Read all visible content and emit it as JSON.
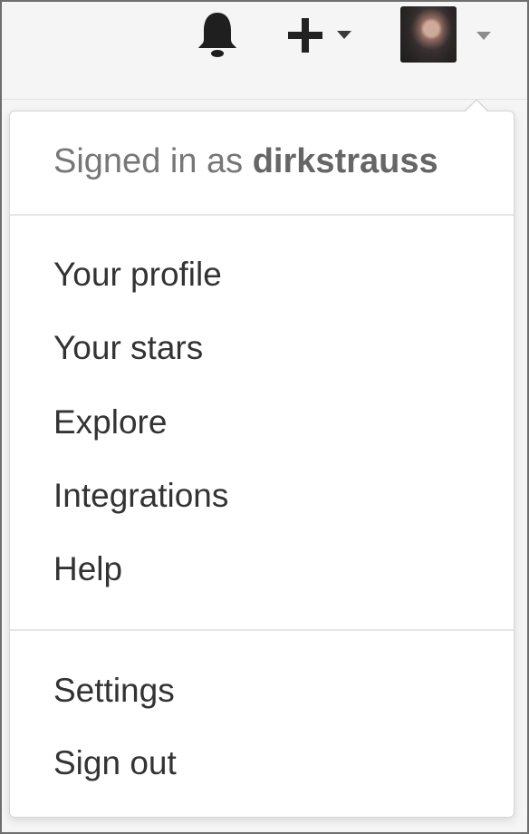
{
  "header": {
    "icons": [
      "bell-icon",
      "plus-icon",
      "chevron-down-icon",
      "avatar"
    ]
  },
  "dropdown": {
    "signed_in_prefix": "Signed in as ",
    "username": "dirkstrauss",
    "primary_items": [
      {
        "label": "Your profile"
      },
      {
        "label": "Your stars"
      },
      {
        "label": "Explore"
      },
      {
        "label": "Integrations"
      },
      {
        "label": "Help"
      }
    ],
    "secondary_items": [
      {
        "label": "Settings"
      },
      {
        "label": "Sign out"
      }
    ]
  },
  "colors": {
    "page_background": "#f5f5f5",
    "menu_background": "#ffffff",
    "text": "#333333",
    "muted_text": "#777777",
    "divider": "#e6e6e6"
  }
}
